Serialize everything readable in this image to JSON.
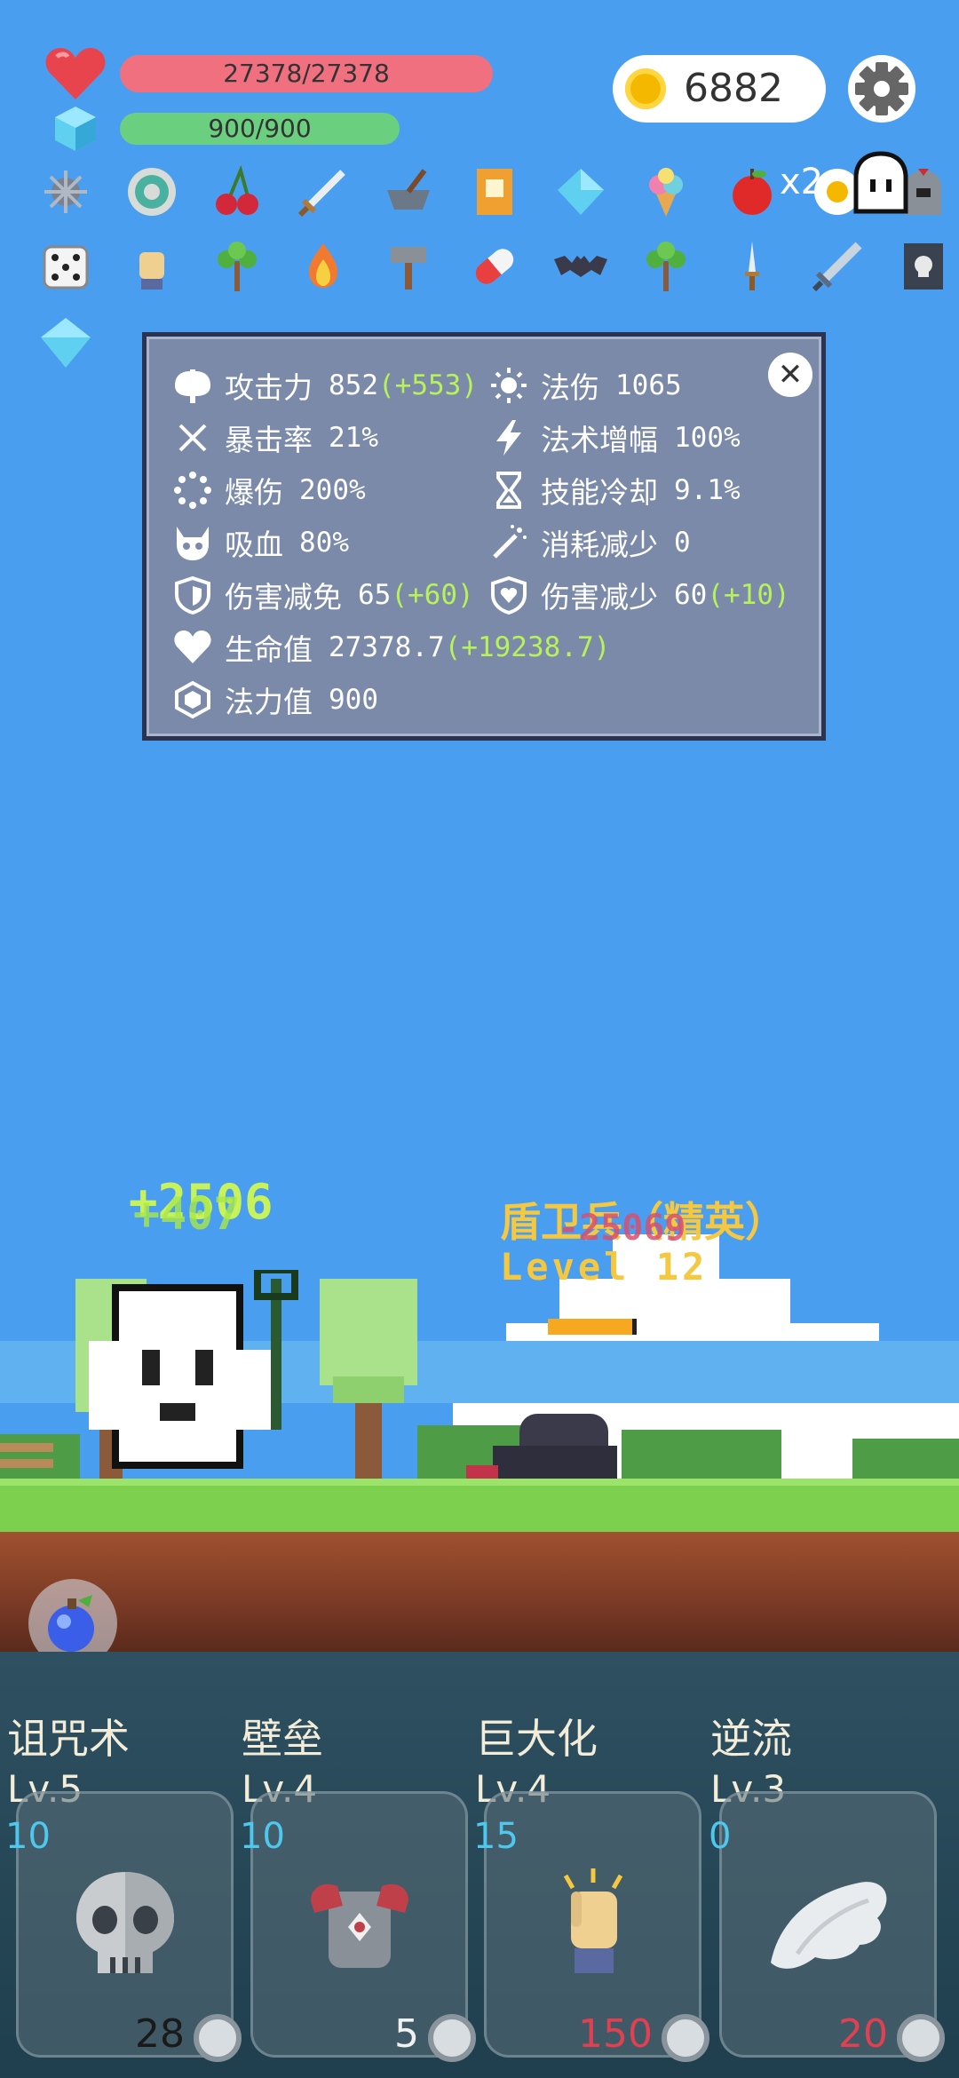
{
  "hud": {
    "hp_text": "27378/27378",
    "mp_text": "900/900",
    "hp_fill": 1.0,
    "mp_fill": 1.0,
    "coins": "6882",
    "multiplier": "x2",
    "colors": {
      "hp": "#f07080",
      "mp": "#6ad080",
      "coin": "#f5b800"
    }
  },
  "items_row1": [
    "spiked-mace-icon",
    "ring-target-icon",
    "cherries-icon",
    "sword-icon",
    "mortar-icon",
    "book-icon",
    "blue-crystal-icon",
    "ice-cream-icon",
    "apple-icon",
    "fried-egg-icon",
    "helmet-icon"
  ],
  "items_row2": [
    "dice-icon",
    "glove-icon",
    "sapling-icon",
    "campfire-icon",
    "hammer-icon",
    "pill-icon",
    "bat-icon",
    "sapling-icon",
    "dagger-icon",
    "greatsword-icon",
    "skull-book-icon"
  ],
  "items_row3": [
    "diamond-icon"
  ],
  "stats": {
    "attack": {
      "label": "攻击力",
      "value": "852",
      "bonus": "(+553)"
    },
    "crit_rate": {
      "label": "暴击率",
      "value": "21%"
    },
    "crit_dmg": {
      "label": "爆伤",
      "value": "200%"
    },
    "lifesteal": {
      "label": "吸血",
      "value": "80%"
    },
    "dmg_reduction": {
      "label": "伤害减免",
      "value": "65",
      "bonus": "(+60)"
    },
    "hp": {
      "label": "生命值",
      "value": "27378.7",
      "bonus": "(+19238.7)"
    },
    "mp": {
      "label": "法力值",
      "value": "900"
    },
    "magic_dmg": {
      "label": "法伤",
      "value": "1065"
    },
    "spell_amp": {
      "label": "法术增幅",
      "value": "100%"
    },
    "cooldown": {
      "label": "技能冷却",
      "value": "9.1%"
    },
    "cost_reduce": {
      "label": "消耗减少",
      "value": "0"
    },
    "dmg_decrease": {
      "label": "伤害减少",
      "value": "60",
      "bonus": "(+10)"
    }
  },
  "scene": {
    "heal_text": "+2506",
    "heal_text2": "+407",
    "damage_text": "-25069",
    "enemy_name": "盾卫兵（精英）",
    "enemy_level": "Level 12",
    "enemy_hp_fill": 0.95
  },
  "skills": [
    {
      "name": "诅咒术",
      "level": "Lv.5",
      "cd": "10",
      "cost": "28",
      "icon": "skull-icon",
      "cost_color": "#1a1a1a"
    },
    {
      "name": "壁垒",
      "level": "Lv.4",
      "cd": "10",
      "cost": "5",
      "icon": "armor-icon",
      "cost_color": "#f0f0f0"
    },
    {
      "name": "巨大化",
      "level": "Lv.4",
      "cd": "15",
      "cost": "150",
      "icon": "fist-icon",
      "cost_color": "#e04050"
    },
    {
      "name": "逆流",
      "level": "Lv.3",
      "cd": "0",
      "cost": "20",
      "icon": "wing-icon",
      "cost_color": "#e04050"
    }
  ]
}
